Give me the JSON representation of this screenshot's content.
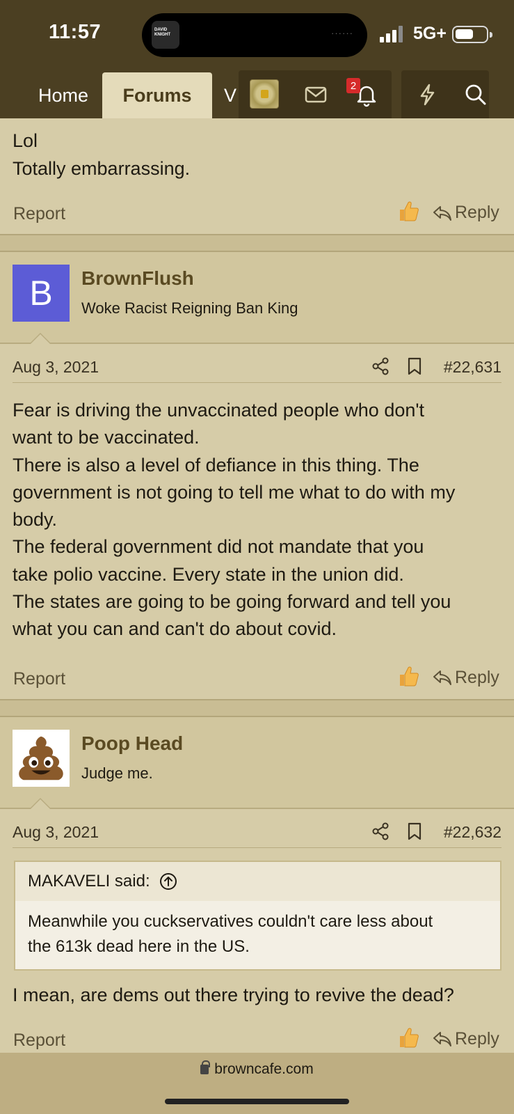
{
  "status": {
    "time": "11:57",
    "network": "5G+",
    "island_app": "DAVID KNIGHT"
  },
  "nav": {
    "home": "Home",
    "forums": "Forums",
    "more": "V",
    "notification_count": "2"
  },
  "colors": {
    "header_bg": "#4b3f22",
    "page_bg": "#d6cca8",
    "avatar_b": "#5c5cd6",
    "badge": "#d62b2b"
  },
  "top_post": {
    "lines": [
      "Lol",
      "Totally embarrassing."
    ]
  },
  "actions": {
    "report": "Report",
    "reply": "Reply"
  },
  "posts": [
    {
      "avatar_letter": "B",
      "username": "BrownFlush",
      "user_title": "Woke Racist Reigning Ban King",
      "date": "Aug 3, 2021",
      "post_number": "#22,631",
      "lines": [
        "Fear is driving the unvaccinated people who don't",
        "want to be vaccinated.",
        "There is also a level of defiance in this thing. The",
        "government is not going to tell me what to do with my",
        "body.",
        "The federal government did not mandate that you",
        "take polio vaccine. Every state in the union did.",
        "The states are going to be going forward and tell you",
        "what you can and can't do about covid."
      ]
    },
    {
      "avatar_icon": "poop-emoji-icon",
      "username": "Poop Head",
      "user_title": "Judge me.",
      "date": "Aug 3, 2021",
      "post_number": "#22,632",
      "quote": {
        "author": "MAKAVELI said:",
        "lines": [
          "Meanwhile you cuckservatives couldn't care less about",
          "the 613k dead here in the US."
        ]
      },
      "lines": [
        "I mean, are dems out there trying to revive the dead?"
      ]
    }
  ],
  "browser": {
    "url": "browncafe.com"
  }
}
